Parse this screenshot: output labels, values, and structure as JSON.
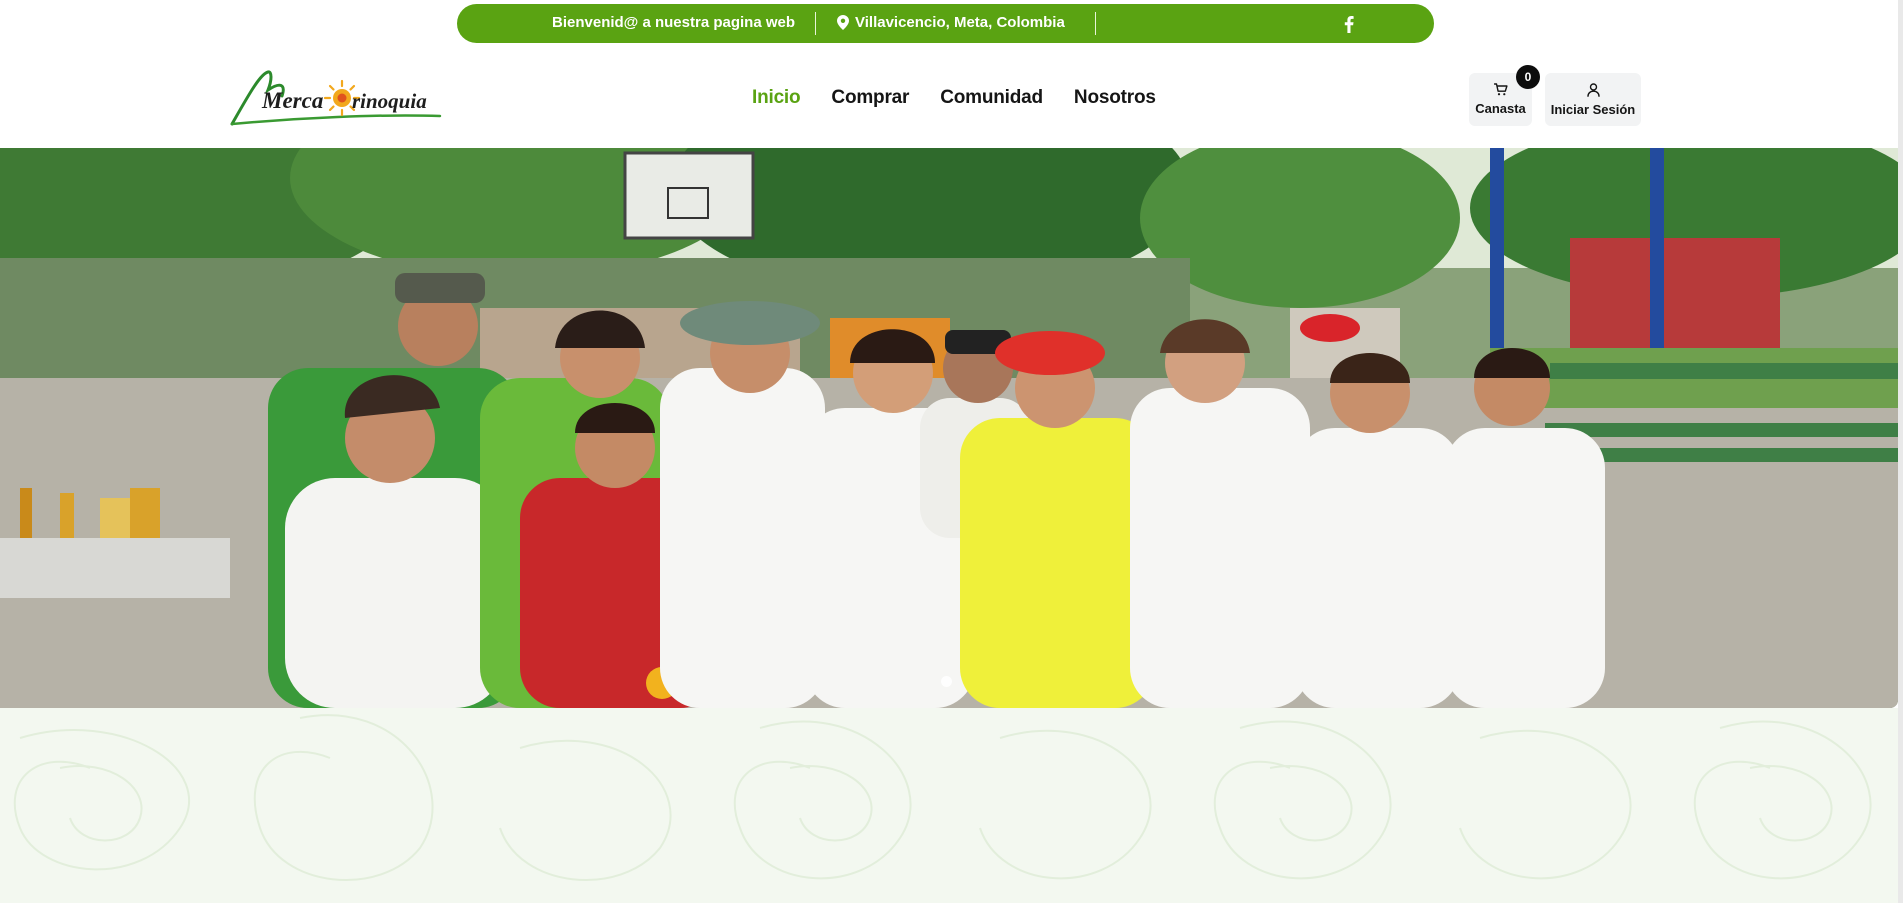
{
  "topbar": {
    "welcome": "Bienvenid@ a nuestra pagina web",
    "location": "Villavicencio, Meta, Colombia",
    "location_icon": "map-pin-icon",
    "social_icon": "facebook-icon",
    "color": "#5aa312"
  },
  "logo": {
    "text_part1": "Merca",
    "text_part2": "rinoquia"
  },
  "nav": {
    "items": [
      {
        "label": "Inicio",
        "active": true
      },
      {
        "label": "Comprar",
        "active": false
      },
      {
        "label": "Comunidad",
        "active": false
      },
      {
        "label": "Nosotros",
        "active": false
      }
    ]
  },
  "header_actions": {
    "cart_label": "Canasta",
    "cart_count": "0",
    "cart_icon": "cart-icon",
    "login_label": "Iniciar Sesión",
    "login_icon": "user-icon"
  },
  "hero": {
    "slides_count": 1,
    "active_slide": 1
  },
  "colors": {
    "brand_green": "#5aa312",
    "text_dark": "#151515",
    "bottom_bg": "#f3f8f0"
  }
}
